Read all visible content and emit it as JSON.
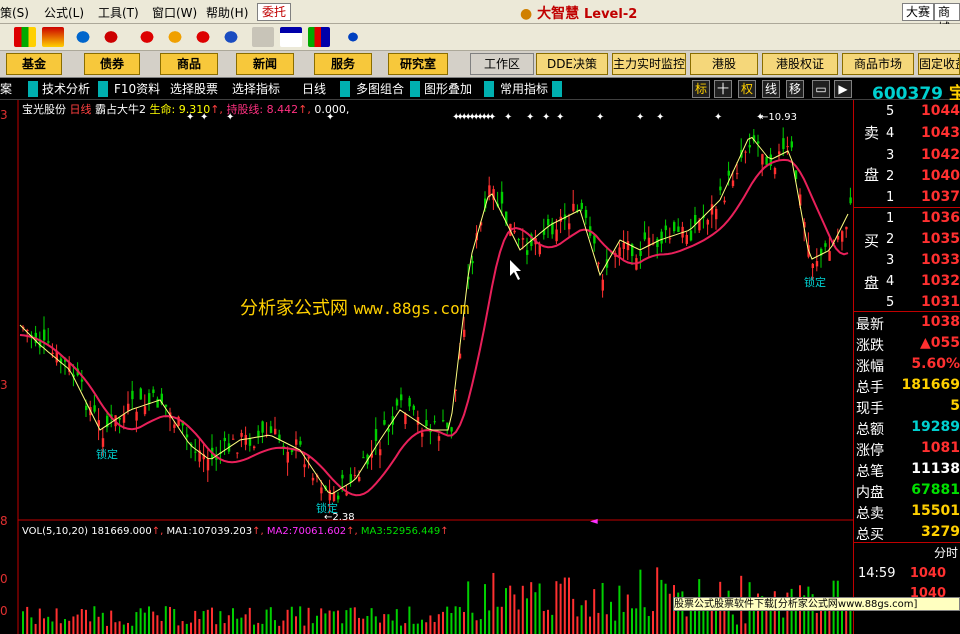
{
  "menu": {
    "items": [
      "策(S)",
      "公式(L)",
      "工具(T)",
      "窗口(W)",
      "帮助(H)"
    ],
    "trade_label": "委托",
    "logo": "大智慧",
    "logo_level": "Level-2",
    "right_buttons": [
      "大赛",
      "商城"
    ]
  },
  "nav": {
    "buttons": [
      "基金",
      "债券",
      "商品",
      "新闻",
      "服务",
      "研究室"
    ],
    "workarea": "工作区",
    "light_buttons": [
      "DDE决策",
      "主力实时监控",
      "港股",
      "港股权证",
      "商品市场",
      "固定收益"
    ]
  },
  "tabs": {
    "items": [
      "案",
      "技术分析",
      "F10资料",
      "选择股票",
      "选择指标",
      "日线",
      "多图组合",
      "图形叠加",
      "常用指标"
    ],
    "right": [
      "标",
      "十",
      "权",
      "线",
      "移"
    ]
  },
  "stock": {
    "code": "600379",
    "name_char": "宝",
    "title_name": "宝光股份",
    "title_period": "日线",
    "indicator": "霸占大牛2",
    "life_label": "生命:",
    "life_value": "9.310",
    "hold_label": "持股线:",
    "hold_value": "8.442",
    "zero": "0.000,"
  },
  "chart": {
    "high_label": "10.93",
    "low_label": "2.38",
    "lock_label": "锁定",
    "axis_left": [
      "3",
      "3",
      "8",
      "0",
      "0"
    ],
    "watermark_cn": "分析家公式网",
    "watermark_url": "www.88gs.com"
  },
  "volume": {
    "label": "VOL(5,10,20)",
    "vol": "181669.000",
    "ma1_label": "MA1:",
    "ma1": "107039.203",
    "ma2_label": "MA2:",
    "ma2": "70061.602",
    "ma3_label": "MA3:",
    "ma3": "52956.449"
  },
  "orderbook": {
    "sell_label": [
      "卖",
      "盘"
    ],
    "buy_label": [
      "买",
      "盘"
    ],
    "sell": [
      {
        "n": "5",
        "p": "1044"
      },
      {
        "n": "4",
        "p": "1043"
      },
      {
        "n": "3",
        "p": "1042"
      },
      {
        "n": "2",
        "p": "1040"
      },
      {
        "n": "1",
        "p": "1037"
      }
    ],
    "buy": [
      {
        "n": "1",
        "p": "1036"
      },
      {
        "n": "2",
        "p": "1035"
      },
      {
        "n": "3",
        "p": "1033"
      },
      {
        "n": "4",
        "p": "1032"
      },
      {
        "n": "5",
        "p": "1031"
      }
    ]
  },
  "quote": [
    {
      "k": "最新",
      "v": "1038",
      "c": "#ff3030"
    },
    {
      "k": "涨跌",
      "v": "▲055",
      "c": "#ff3030"
    },
    {
      "k": "涨幅",
      "v": "5.60%",
      "c": "#ff3030"
    },
    {
      "k": "总手",
      "v": "181669",
      "c": "#ffd000"
    },
    {
      "k": "现手",
      "v": "5",
      "c": "#ffd000"
    },
    {
      "k": "总额",
      "v": "19289",
      "c": "#00d0d0"
    },
    {
      "k": "涨停",
      "v": "1081",
      "c": "#ff3030"
    },
    {
      "k": "总笔",
      "v": "11138",
      "c": "#ffffff"
    },
    {
      "k": "内盘",
      "v": "67881",
      "c": "#00e000"
    },
    {
      "k": "总卖",
      "v": "15501",
      "c": "#ffd000"
    },
    {
      "k": "总买",
      "v": "3279",
      "c": "#ffd000"
    }
  ],
  "ticks": {
    "title": "分时",
    "row_time": "14:59",
    "row_price": "1040",
    "row2_price": "1040"
  },
  "footer": "股票公式股票软件下载[分析家公式网www.88gs.com]",
  "colors": {
    "ma": "#e8205a",
    "up": "#ff3030",
    "down": "#00d000",
    "line": "#ffff80"
  }
}
